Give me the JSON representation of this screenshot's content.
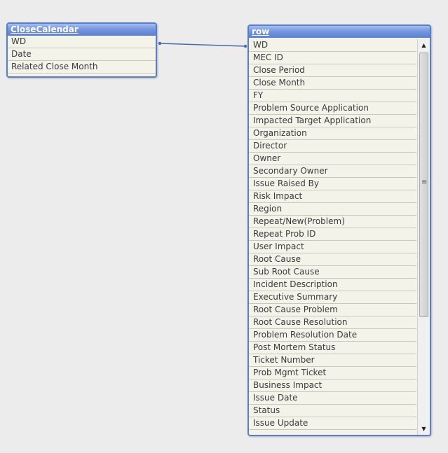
{
  "close_calendar": {
    "title": "CloseCalendar",
    "fields": [
      "WD",
      "Date",
      "Related Close Month"
    ]
  },
  "row_table": {
    "title": "row",
    "fields": [
      "WD",
      "MEC ID",
      "Close Period",
      "Close Month",
      "FY",
      "Problem Source Application",
      "Impacted Target Application",
      "Organization",
      "Director",
      "Owner",
      "Secondary Owner",
      "Issue Raised By",
      "Risk Impact",
      "Region",
      "Repeat/New(Problem)",
      "Repeat Prob ID",
      "User Impact",
      "Root Cause",
      "Sub Root Cause",
      "Incident Description",
      "Executive Summary",
      "Root Cause Problem",
      "Root Cause Resolution",
      "Problem Resolution Date",
      "Post Mortem Status",
      "Ticket Number",
      "Prob Mgmt Ticket",
      "Business Impact",
      "Issue Date",
      "Status",
      "Issue Update"
    ]
  },
  "colors": {
    "header_start": "#a4bdf0",
    "header_end": "#5b7fd1",
    "border": "#5a7ecb",
    "row_bg": "#f4f3ea",
    "canvas": "#ececec",
    "link_line": "#4a6aa8"
  },
  "icons": {
    "scroll_up": "scroll-up-arrow-icon",
    "scroll_down": "scroll-down-arrow-icon",
    "grip": "scroll-thumb-grip-icon"
  }
}
